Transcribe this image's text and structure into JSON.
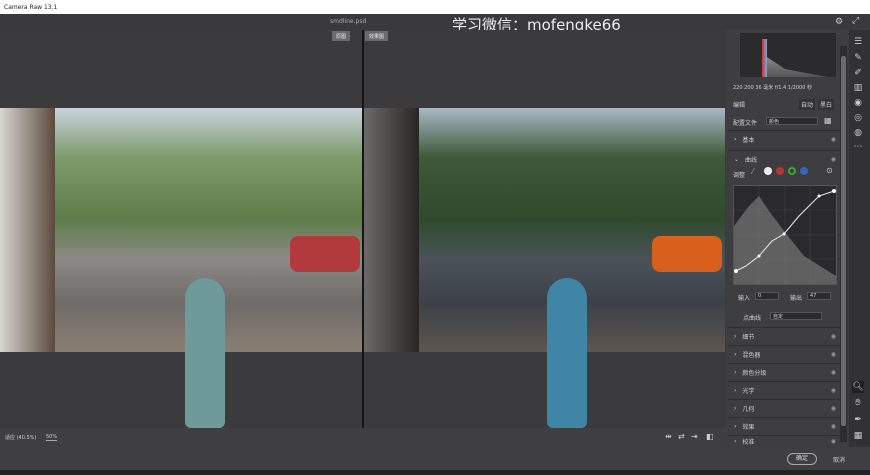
{
  "window": {
    "title": "Camera Raw 13.1"
  },
  "header": {
    "filename": "smdline.psd",
    "watermark": "学习微信：mofengke66",
    "before_label": "原图",
    "after_label": "效果图"
  },
  "exif": "220 200  36 毫米   f/1.4   1/2000 秒",
  "edit": {
    "title": "编辑",
    "auto": "自动",
    "bw": "黑白",
    "profile_label": "配置文件",
    "profile_value": "颜色"
  },
  "panels": {
    "basic": "基本",
    "curve": "曲线",
    "adjust": "调整"
  },
  "curve": {
    "input_label": "输入",
    "input_value": "0",
    "output_label": "输出",
    "output_value": "47",
    "pointcurve_label": "点曲线",
    "pointcurve_value": "自定"
  },
  "sections": [
    "细节",
    "混色器",
    "颜色分级",
    "光学",
    "几何",
    "效果",
    "校准"
  ],
  "bottom": {
    "fit": "适应 (40.5%)",
    "zoom": "50%"
  },
  "footer": {
    "ok": "确定",
    "cancel": "取消"
  }
}
